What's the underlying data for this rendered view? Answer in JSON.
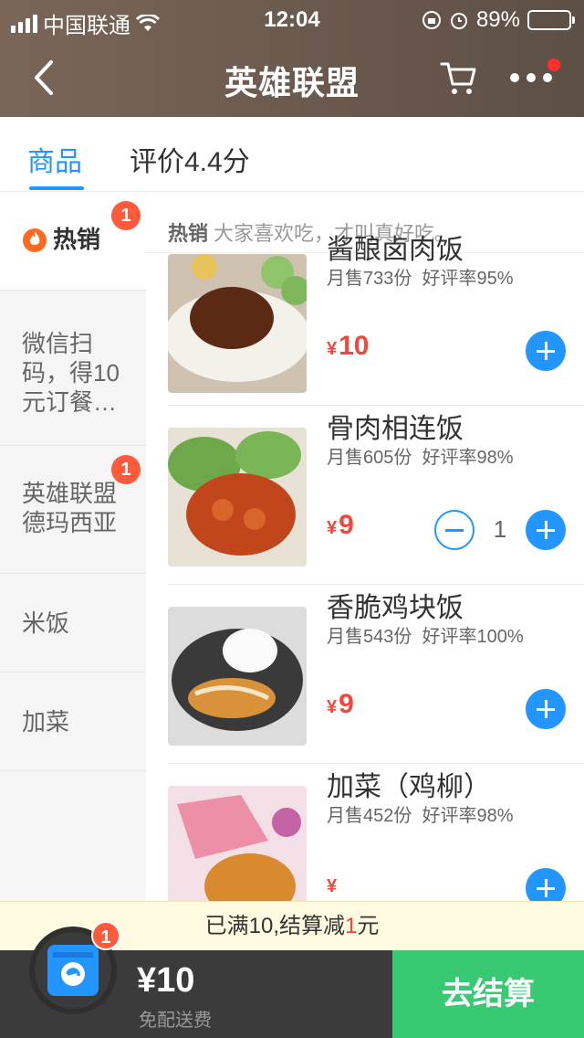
{
  "status_bar": {
    "carrier": "中国联通",
    "time": "12:04",
    "battery": "89%",
    "battery_level": 0.89
  },
  "nav": {
    "title": "英雄联盟",
    "icons": [
      "back-chevron-icon",
      "cart-icon",
      "more-dots-icon"
    ]
  },
  "tabs": [
    {
      "label": "商品",
      "active": true
    },
    {
      "label": "评价4.4分",
      "active": false
    }
  ],
  "sidebar": {
    "items": [
      {
        "label": "热销",
        "badge": "1",
        "active": true
      },
      {
        "label": "微信扫码，得10元订餐…",
        "badge": ""
      },
      {
        "label": "英雄联盟德玛西亚",
        "badge": "1"
      },
      {
        "label": "米饭",
        "badge": ""
      },
      {
        "label": "加菜",
        "badge": ""
      }
    ]
  },
  "section": {
    "title": "热销",
    "desc": "大家喜欢吃，才叫真好吃。"
  },
  "items": [
    {
      "name": "酱酿卤肉饭",
      "sales": "月售733份",
      "rating": "好评率95%",
      "currency": "¥",
      "price": "10",
      "qty": ""
    },
    {
      "name": "骨肉相连饭",
      "sales": "月售605份",
      "rating": "好评率98%",
      "currency": "¥",
      "price": "9",
      "qty": "1"
    },
    {
      "name": "香脆鸡块饭",
      "sales": "月售543份",
      "rating": "好评率100%",
      "currency": "¥",
      "price": "9",
      "qty": ""
    },
    {
      "name": "加菜（鸡柳）",
      "sales": "月售452份",
      "rating": "好评率98%",
      "currency": "¥",
      "price": "",
      "qty": ""
    }
  ],
  "promo": {
    "prefix": "已满10,结算减",
    "amount": "1",
    "suffix": "元"
  },
  "bottom_bar": {
    "cart_count": "1",
    "total": "¥10",
    "fee": "免配送费",
    "checkout": "去结算"
  },
  "colors": {
    "accent": "#2395ff",
    "price": "#f5463c",
    "checkout": "#38ca73",
    "badge": "#ff5a3c"
  }
}
